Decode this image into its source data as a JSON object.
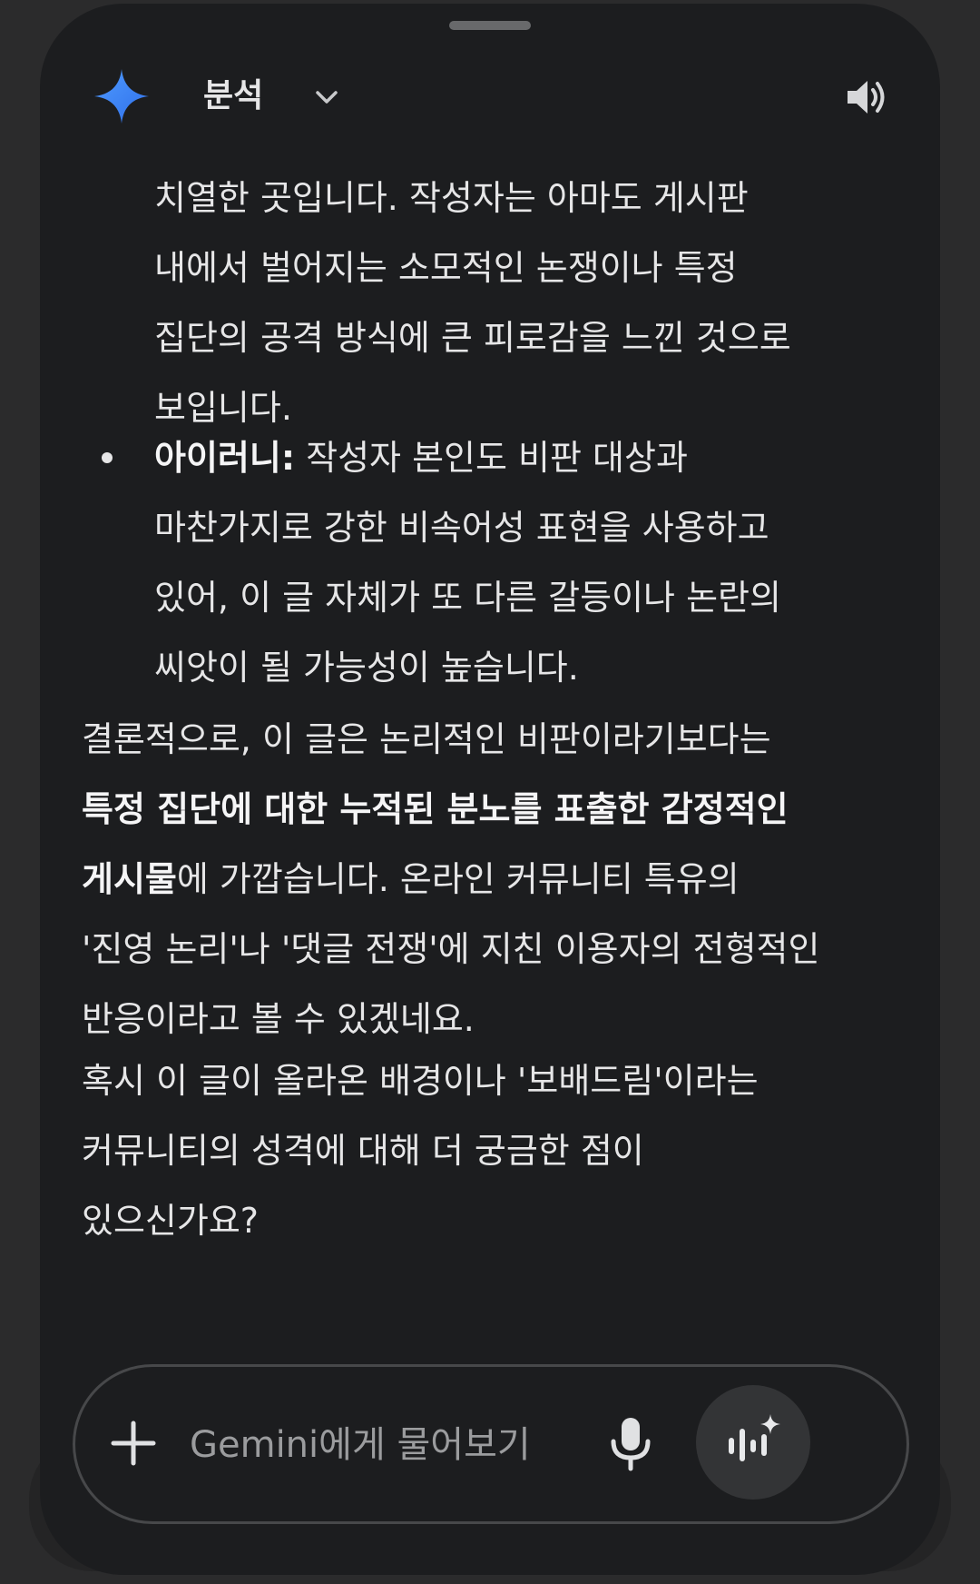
{
  "header": {
    "model_label": "분석"
  },
  "conversation": {
    "para_top": [
      "치열한 곳입니다. 작성자는 아마도 게시판",
      "내에서 벌어지는 소모적인 논쟁이나 특정",
      "집단의 공격 방식에 큰 피로감을 느낀 것으로",
      "보입니다."
    ],
    "bullet_irony": {
      "bold_label": "아이러니:",
      "first_rest": " 작성자 본인도 비판 대상과",
      "lines": [
        "마찬가지로 강한 비속어성 표현을 사용하고",
        "있어, 이 글 자체가 또 다른 갈등이나 논란의",
        "씨앗이 될 가능성이 높습니다."
      ]
    },
    "conclusion": {
      "line1": "결론적으로, 이 글은 논리적인 비판이라기보다는",
      "bold_line2": "특정 집단에 대한 누적된 분노를 표출한 감정적인",
      "bold_line3_part": "게시물",
      "line3_rest": "에 가깝습니다. 온라인 커뮤니티 특유의",
      "line4": "'진영 논리'나 '댓글 전쟁'에 지친 이용자의 전형적인",
      "line5": "반응이라고 볼 수 있겠네요."
    },
    "question": {
      "lines": [
        "혹시 이 글이 올라온 배경이나 '보배드림'이라는",
        "커뮤니티의 성격에 대해 더 궁금한 점이",
        "있으신가요?"
      ]
    }
  },
  "input": {
    "placeholder": "Gemini에게 물어보기"
  },
  "icons": {
    "logo": "gemini-sparkle-icon",
    "chevron": "chevron-down-icon",
    "speaker": "speaker-icon",
    "plus": "plus-icon",
    "mic": "microphone-icon",
    "live": "gemini-live-icon"
  },
  "colors": {
    "background": "#1c1d1f",
    "text": "#e6e6e7",
    "placeholder": "#9b9c9e",
    "logo_blue": "#3b82f6"
  }
}
